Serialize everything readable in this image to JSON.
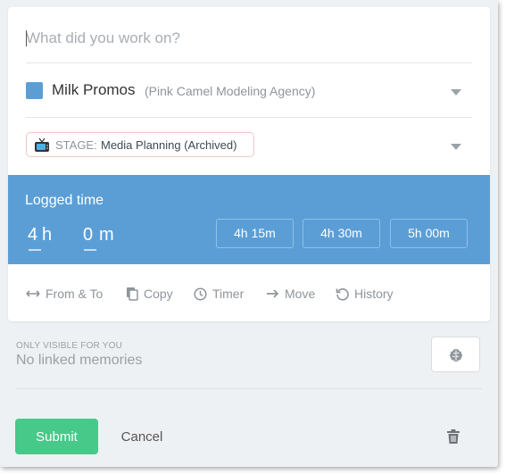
{
  "description": {
    "placeholder": "What did you work on?",
    "value": ""
  },
  "project": {
    "name": "Milk Promos",
    "client": "(Pink Camel Modeling Agency)",
    "color": "#5b9ed6"
  },
  "stage": {
    "prefix": "STAGE:",
    "name": "Media Planning (Archived)",
    "icon": "tv-icon"
  },
  "logged_time": {
    "title": "Logged time",
    "hours": "4",
    "hours_unit": "h",
    "minutes": "0",
    "minutes_unit": "m",
    "presets": [
      "4h 15m",
      "4h 30m",
      "5h 00m"
    ],
    "band_color": "#5b9ed6"
  },
  "actions": [
    {
      "label": "From & To",
      "icon": "arrows-horizontal-icon"
    },
    {
      "label": "Copy",
      "icon": "copy-icon"
    },
    {
      "label": "Timer",
      "icon": "clock-icon"
    },
    {
      "label": "Move",
      "icon": "arrow-right-icon"
    },
    {
      "label": "History",
      "icon": "history-icon"
    }
  ],
  "memories": {
    "visibility_note": "ONLY VISIBLE FOR YOU",
    "status": "No linked memories",
    "icon": "brain-icon"
  },
  "footer": {
    "submit_label": "Submit",
    "cancel_label": "Cancel",
    "delete_icon": "trash-icon",
    "submit_color": "#47c98a"
  }
}
